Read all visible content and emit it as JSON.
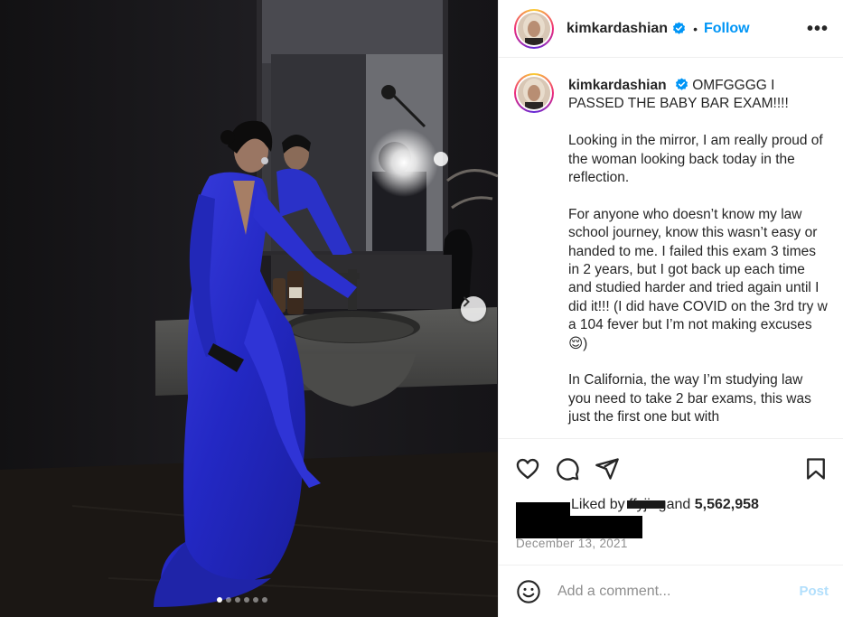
{
  "post": {
    "username": "kimkardashian",
    "separator": "•",
    "follow_label": "Follow",
    "more_label": "•••",
    "caption": {
      "username": "kimkardashian",
      "lead": "OMFGGGG I PASSED THE BABY BAR EXAM!!!!",
      "paragraph_1": "Looking in the mirror, I am really proud of the woman looking back today in the reflection.",
      "paragraph_2": "For anyone who doesn’t know my law school journey, know this wasn’t easy or handed to me. I failed this exam 3 times in 2 years, but I got back up each time and studied harder and tried again until I did it!!! (I did have COVID on the 3rd try w a 104 fever but I’m not making excuses😌)",
      "paragraph_3": "In California, the way I’m studying law you need to take 2 bar exams, this was just the first one but with"
    },
    "likes": {
      "prefix": "Liked by",
      "redacted_name": "ffyjing",
      "middle": "and",
      "count": "5,562,958"
    },
    "date": "December 13, 2021",
    "comment": {
      "placeholder": "Add a comment...",
      "post_label": "Post"
    },
    "carousel": {
      "total": 6,
      "active_index": 0
    },
    "icons": {
      "verified": "verified-badge-icon",
      "like": "heart-icon",
      "comment": "comment-bubble-icon",
      "share": "paper-plane-icon",
      "save": "bookmark-icon",
      "emoji": "smiley-icon",
      "next": "chevron-right-icon"
    },
    "colors": {
      "accent": "#0095f6",
      "dress_blue": "#2a2fcf",
      "post_disabled": "#b2dffc",
      "muted_text": "#8e8e8e"
    }
  }
}
